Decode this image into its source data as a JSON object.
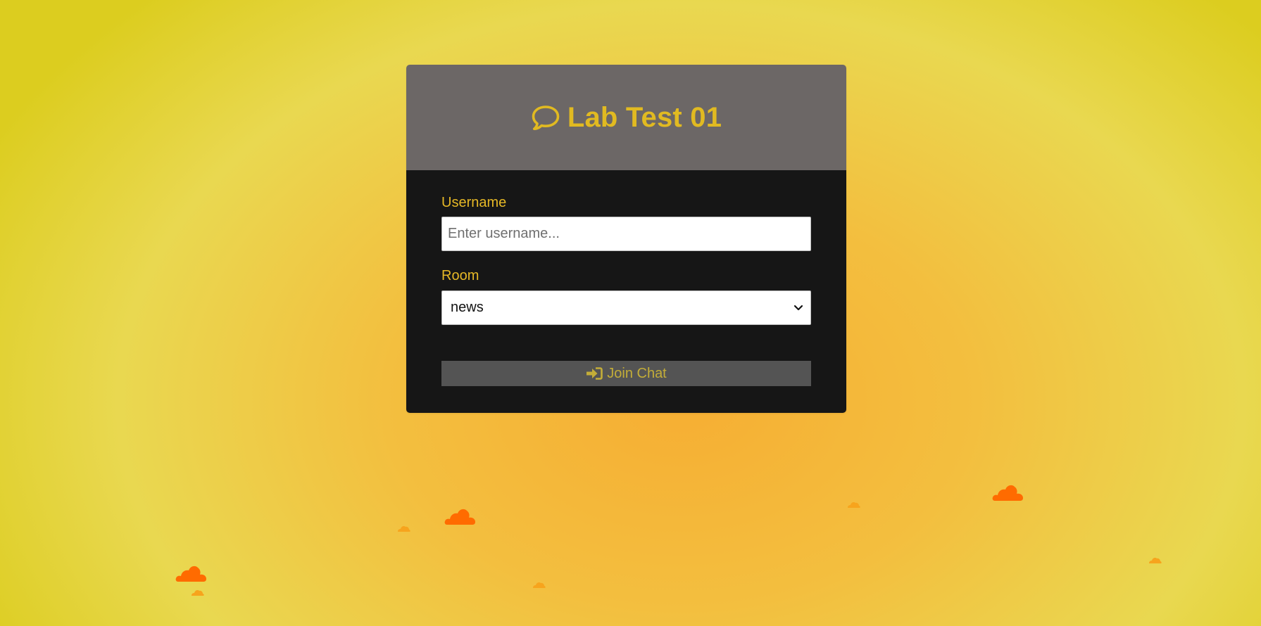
{
  "header": {
    "title": "Lab Test 01",
    "icon": "chat-bubble-icon"
  },
  "form": {
    "username_label": "Username",
    "username_placeholder": "Enter username...",
    "username_value": "",
    "room_label": "Room",
    "room_selected": "news",
    "join_button_label": "Join Chat",
    "join_icon": "sign-in-icon"
  },
  "colors": {
    "accent": "#e1ba21",
    "header_bg": "#6c6766",
    "body_bg": "#161616",
    "button_bg": "#545454",
    "button_text": "#c3ad38",
    "cloud_large": "#ff6b00",
    "cloud_small": "#f7a41d"
  },
  "decorations": {
    "cloud_icon": "cloud-icon"
  }
}
